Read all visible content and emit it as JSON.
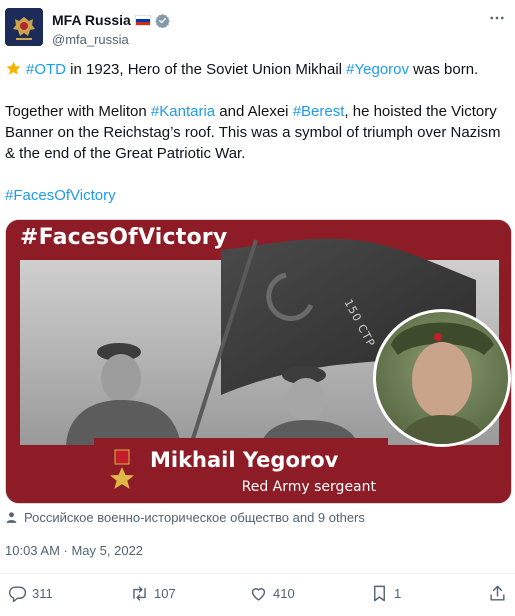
{
  "account": {
    "display_name": "MFA Russia",
    "handle": "@mfa_russia",
    "flag_colors": [
      "#ffffff",
      "#0039a6",
      "#d52b1e"
    ],
    "verified_color": "#829aab",
    "avatar_color": "#1d2b58"
  },
  "tweet": {
    "line1": {
      "prefix_icon": "star-emoji",
      "tag1": "#OTD",
      "text1": " in 1923, Hero of the Soviet Union Mikhail ",
      "tag2": "#Yegorov",
      "text2": " was born."
    },
    "line2": {
      "text1": "Together with Meliton ",
      "tag1": "#Kantaria",
      "text2": " and Alexei ",
      "tag2": "#Berest",
      "text3": ", he hoisted the Victory Banner on the Reichstag’s roof. This was a symbol of triumph over Nazism & the end of the Great Patriotic War."
    },
    "line3": {
      "tag": "#FacesOfVictory"
    },
    "link_color": "#1d9bf0"
  },
  "media": {
    "title": "#FacesOfVictory",
    "hero_name": "Mikhail Yegorov",
    "hero_rank": "Red Army sergeant",
    "banner_text": "150 СТР",
    "frame_color": "#8e1c26"
  },
  "tagged": {
    "text": "Российское военно-историческое общество and 9 others"
  },
  "meta": {
    "timestamp": "10:03 AM · May 5, 2022"
  },
  "actions": {
    "replies": "311",
    "retweets": "107",
    "likes": "410",
    "views": "1"
  }
}
